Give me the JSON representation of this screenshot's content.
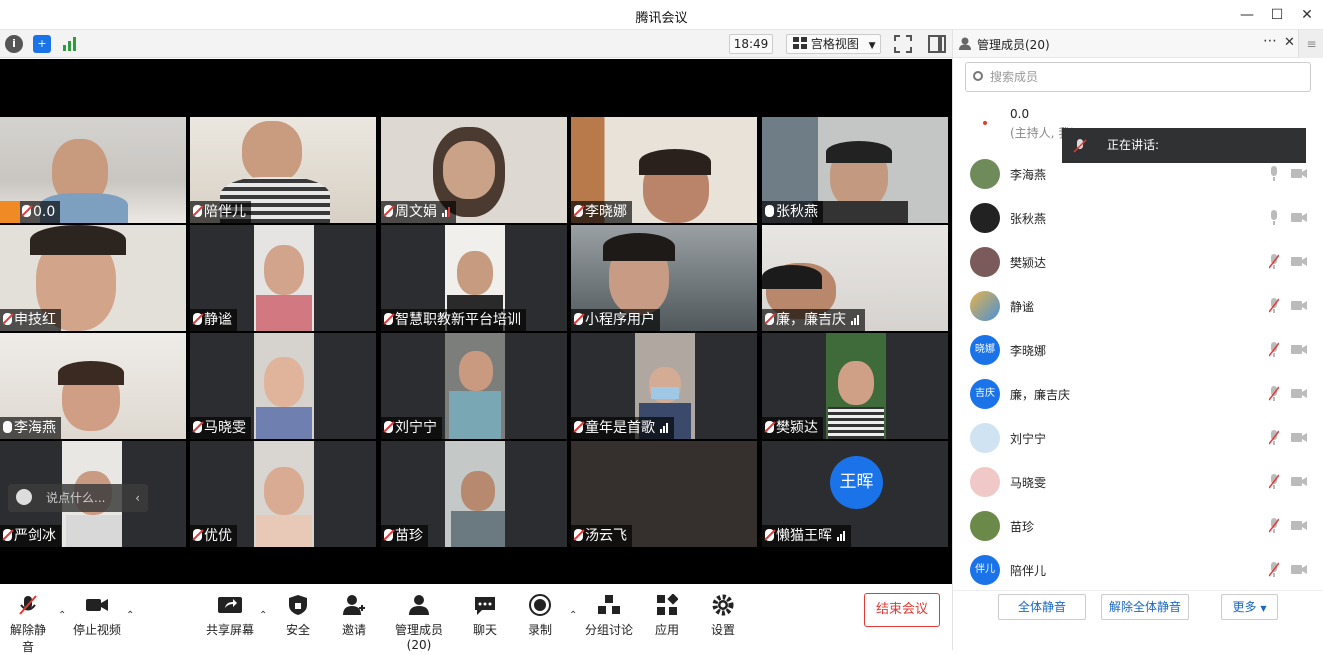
{
  "window": {
    "title": "腾讯会议"
  },
  "toolbar": {
    "clock": "18:49",
    "view_mode": "宫格视图"
  },
  "tiles": [
    {
      "name": "0.0"
    },
    {
      "name": "陪伴儿"
    },
    {
      "name": "周文娟"
    },
    {
      "name": "李晓娜"
    },
    {
      "name": "张秋燕"
    },
    {
      "name": "申技红"
    },
    {
      "name": "静谧"
    },
    {
      "name": "智慧职教新平台培训"
    },
    {
      "name": "小程序用户"
    },
    {
      "name": "廉，廉吉庆"
    },
    {
      "name": "李海燕"
    },
    {
      "name": "马晓雯"
    },
    {
      "name": "刘宁宁"
    },
    {
      "name": "童年是首歌"
    },
    {
      "name": "樊颍达"
    },
    {
      "name": "严剑冰"
    },
    {
      "name": "优优"
    },
    {
      "name": "苗珍"
    },
    {
      "name": "汤云飞"
    },
    {
      "name": "懒猫王晖",
      "avatar_text": "王晖"
    }
  ],
  "chat": {
    "placeholder": "说点什么..."
  },
  "bottombar": {
    "mute": "解除静音",
    "video": "停止视频",
    "share": "共享屏幕",
    "security": "安全",
    "invite": "邀请",
    "members": "管理成员(20)",
    "chat": "聊天",
    "record": "录制",
    "breakout": "分组讨论",
    "apps": "应用",
    "settings": "设置",
    "end": "结束会议"
  },
  "panel": {
    "title": "管理成员(20)",
    "search_placeholder": "搜索成员",
    "speaking_label": "正在讲话:",
    "members": [
      {
        "name": "0.0",
        "sub": "(主持人, 我)"
      },
      {
        "name": "李海燕"
      },
      {
        "name": "张秋燕"
      },
      {
        "name": "樊颍达"
      },
      {
        "name": "静谧"
      },
      {
        "name": "李晓娜",
        "avatar_text": "晓娜"
      },
      {
        "name": "廉，廉吉庆",
        "avatar_text": "吉庆"
      },
      {
        "name": "刘宁宁"
      },
      {
        "name": "马晓雯"
      },
      {
        "name": "苗珍"
      },
      {
        "name": "陪伴儿",
        "avatar_text": "伴儿"
      }
    ],
    "mute_all": "全体静音",
    "unmute_all": "解除全体静音",
    "more": "更多"
  }
}
